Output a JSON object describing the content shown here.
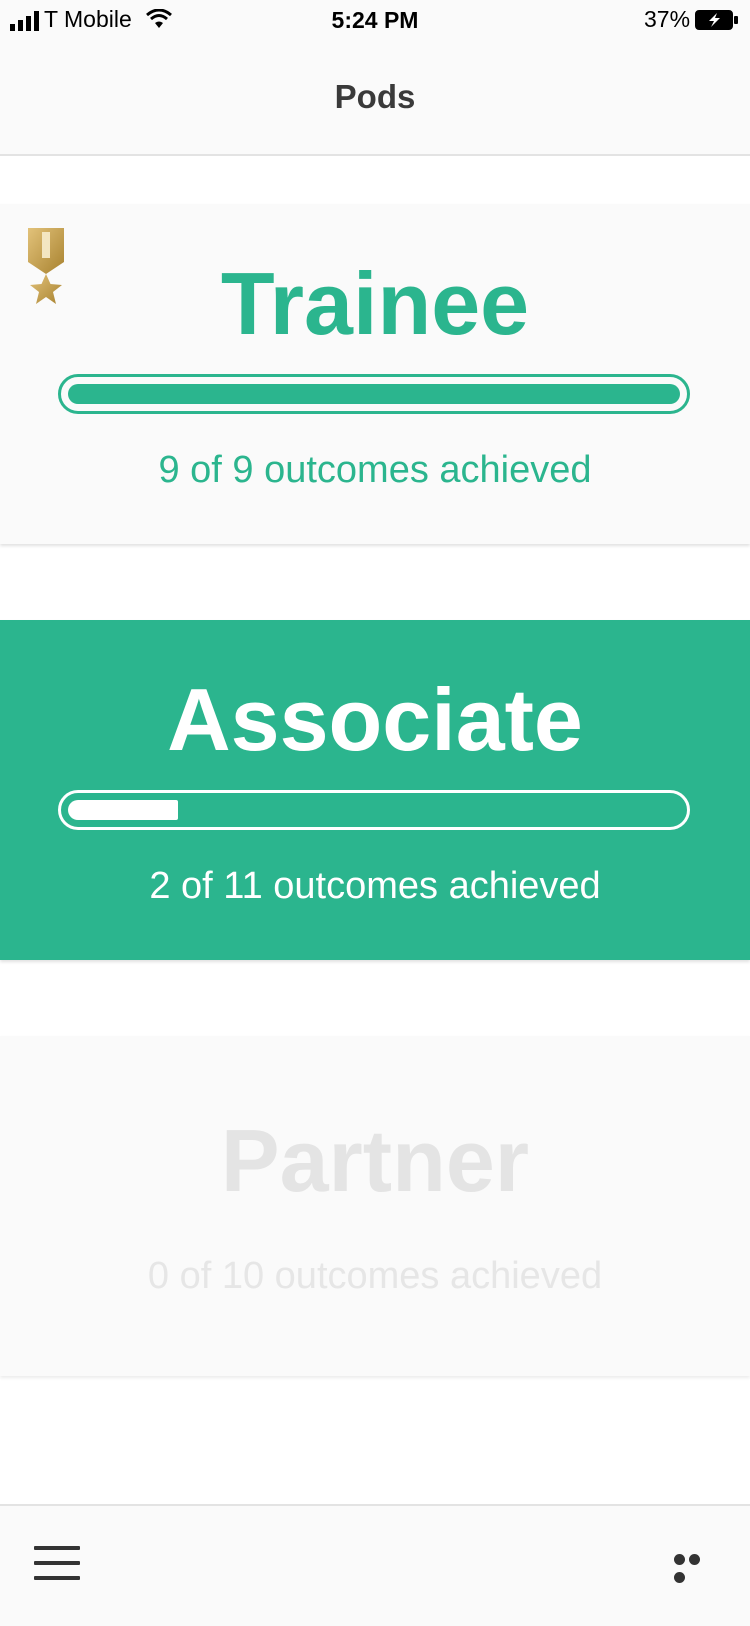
{
  "status_bar": {
    "carrier": "T Mobile",
    "time": "5:24 PM",
    "battery": "37%"
  },
  "nav": {
    "title": "Pods"
  },
  "pods": [
    {
      "title": "Trainee",
      "caption": "9 of 9 outcomes achieved",
      "achieved": 9,
      "total": 9,
      "state": "completed",
      "progress": 1.0
    },
    {
      "title": "Associate",
      "caption": "2 of 11 outcomes achieved",
      "achieved": 2,
      "total": 11,
      "state": "active",
      "progress": 0.18
    },
    {
      "title": "Partner",
      "caption": "0 of 10 outcomes achieved",
      "achieved": 0,
      "total": 10,
      "state": "locked",
      "progress": 0
    }
  ],
  "colors": {
    "accent": "#2bb58e",
    "medal_gold": "#c9a24a",
    "locked_text": "#e4e4e4"
  },
  "icons": {
    "medal": "medal-icon",
    "menu": "hamburger-menu-icon",
    "more": "more-dots-icon"
  }
}
